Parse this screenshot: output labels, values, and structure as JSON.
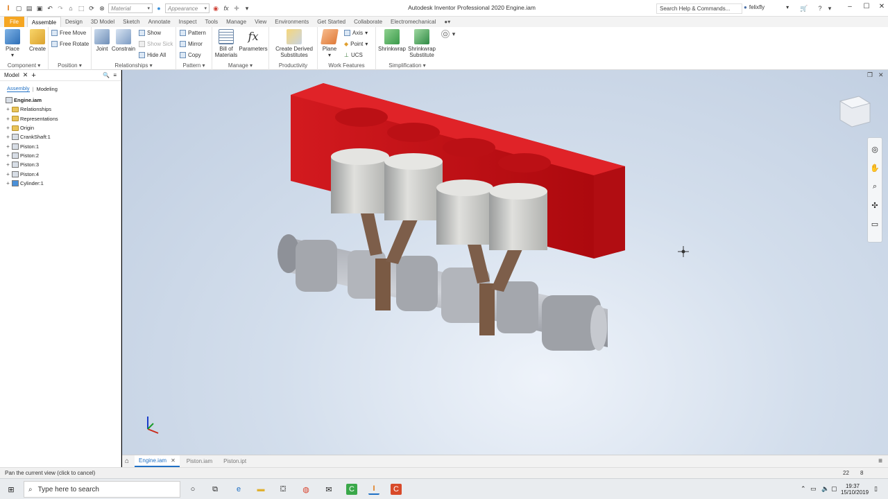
{
  "app": {
    "title": "Autodesk Inventor Professional 2020   Engine.iam",
    "search_placeholder": "Search Help & Commands...",
    "user": "felixfly",
    "material_placeholder": "Material",
    "appearance_placeholder": "Appearance"
  },
  "menu_tabs": [
    "File",
    "Assemble",
    "Design",
    "3D Model",
    "Sketch",
    "Annotate",
    "Inspect",
    "Tools",
    "Manage",
    "View",
    "Environments",
    "Get Started",
    "Collaborate",
    "Electromechanical"
  ],
  "ribbon": {
    "component": {
      "label": "Component",
      "place": "Place",
      "create": "Create"
    },
    "position": {
      "label": "Position",
      "free_move": "Free Move",
      "free_rotate": "Free Rotate"
    },
    "relationships": {
      "label": "Relationships",
      "joint": "Joint",
      "constrain": "Constrain",
      "show": "Show",
      "show_sick": "Show Sick",
      "hide_all": "Hide All"
    },
    "pattern": {
      "label": "Pattern",
      "pattern": "Pattern",
      "mirror": "Mirror",
      "copy": "Copy"
    },
    "manage": {
      "label": "Manage",
      "bom": "Bill of Materials",
      "parameters": "Parameters"
    },
    "productivity": {
      "label": "Productivity",
      "create_derived": "Create Derived Substitutes"
    },
    "work_features": {
      "label": "Work Features",
      "plane": "Plane",
      "axis": "Axis",
      "point": "Point",
      "ucs": "UCS"
    },
    "simplification": {
      "label": "Simplification",
      "shrinkwrap": "Shrinkwrap",
      "shrinkwrap_sub": "Shrinkwrap Substitute"
    }
  },
  "browser": {
    "title": "Model",
    "sub_tabs": [
      "Assembly",
      "Modeling"
    ],
    "root": "Engine.iam",
    "nodes": [
      {
        "label": "Relationships",
        "icon": "folder-icon"
      },
      {
        "label": "Representations",
        "icon": "folder-icon"
      },
      {
        "label": "Origin",
        "icon": "folder-icon"
      },
      {
        "label": "CrankShaft:1",
        "icon": "part-icon"
      },
      {
        "label": "Piston:1",
        "icon": "part-icon"
      },
      {
        "label": "Piston:2",
        "icon": "part-icon"
      },
      {
        "label": "Piston:3",
        "icon": "part-icon"
      },
      {
        "label": "Piston:4",
        "icon": "part-icon"
      },
      {
        "label": "Cylinder:1",
        "icon": "cylinder-part-icon"
      }
    ]
  },
  "documents": [
    "Engine.iam",
    "Piston.iam",
    "Piston.ipt"
  ],
  "status": {
    "message": "Pan the current view (click to cancel)",
    "count1": "22",
    "count2": "8"
  },
  "taskbar": {
    "search": "Type here to search",
    "time": "19:37",
    "date": "15/10/2019"
  },
  "colors": {
    "file_tab": "#f5a623",
    "accent": "#1e6fc4",
    "cylinder_block": "#c8151a"
  }
}
